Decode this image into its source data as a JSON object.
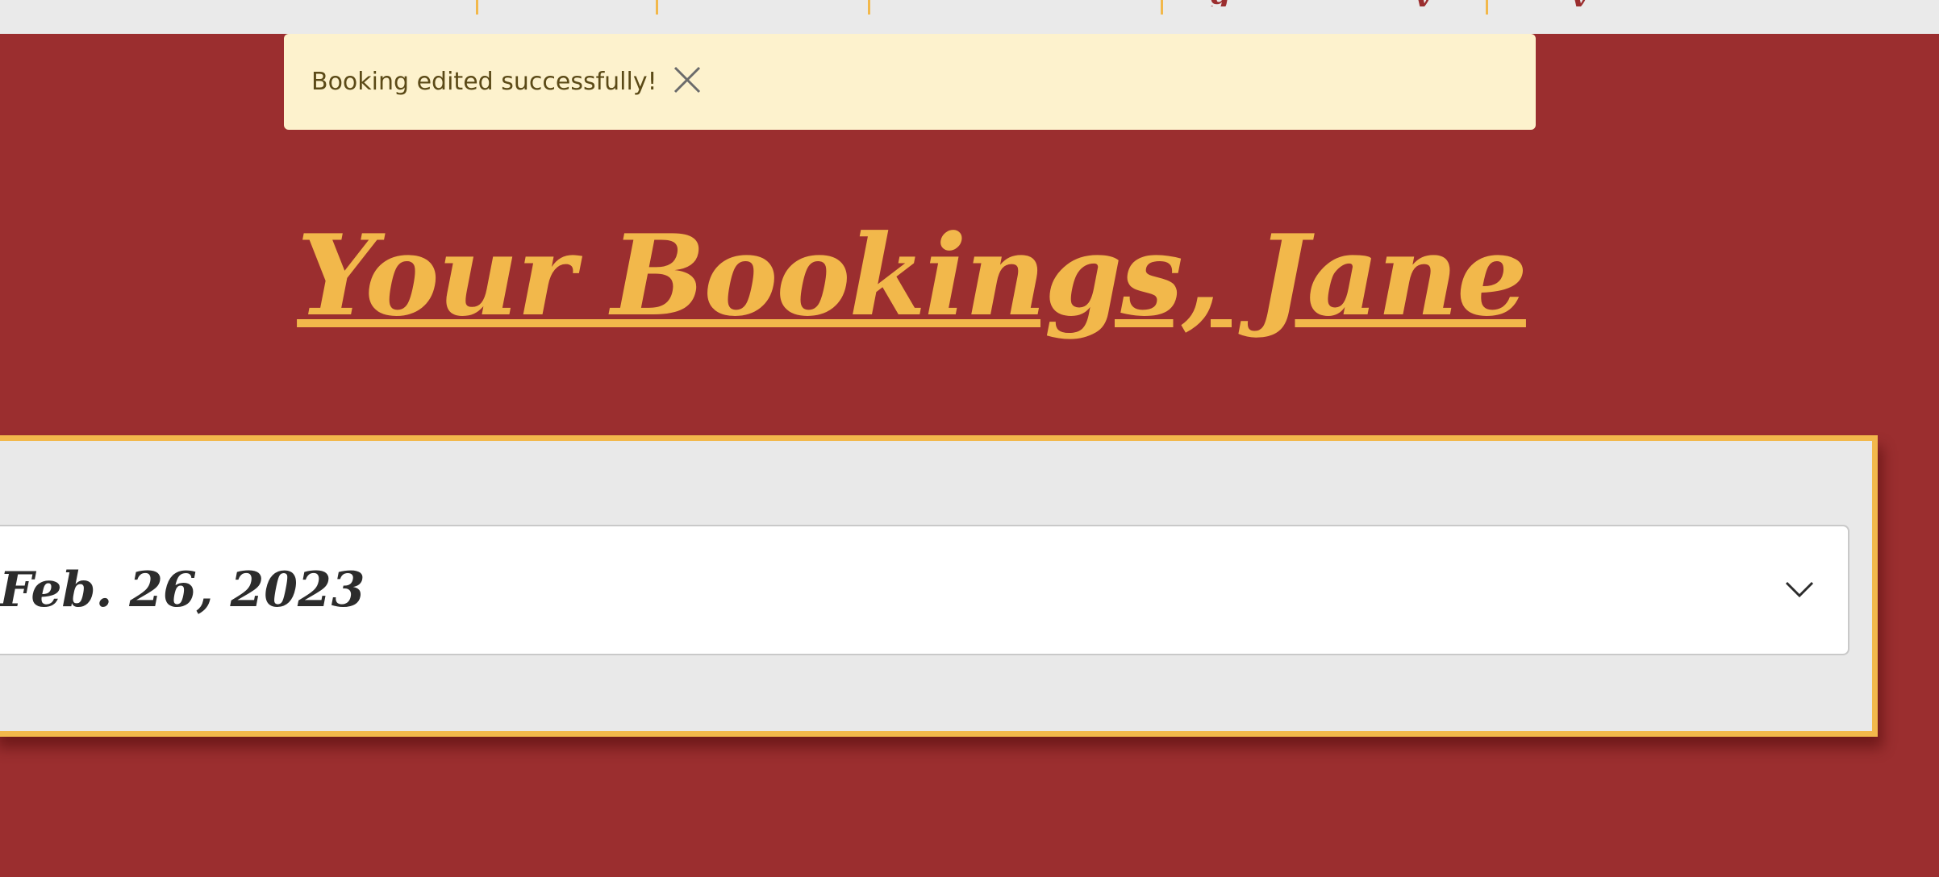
{
  "alert": {
    "message": "Booking edited successfully!",
    "close_icon": "close-icon"
  },
  "heading": {
    "title": "Your Bookings, Jane"
  },
  "bookings": [
    {
      "date": "Feb. 26, 2023",
      "toggle_icon": "chevron-down-icon"
    }
  ],
  "colors": {
    "background": "#9b2e2f",
    "accent": "#f2b84b",
    "alert_bg": "#fdf2cd",
    "alert_text": "#5b4a17",
    "panel_bg": "#e9e9e9"
  }
}
